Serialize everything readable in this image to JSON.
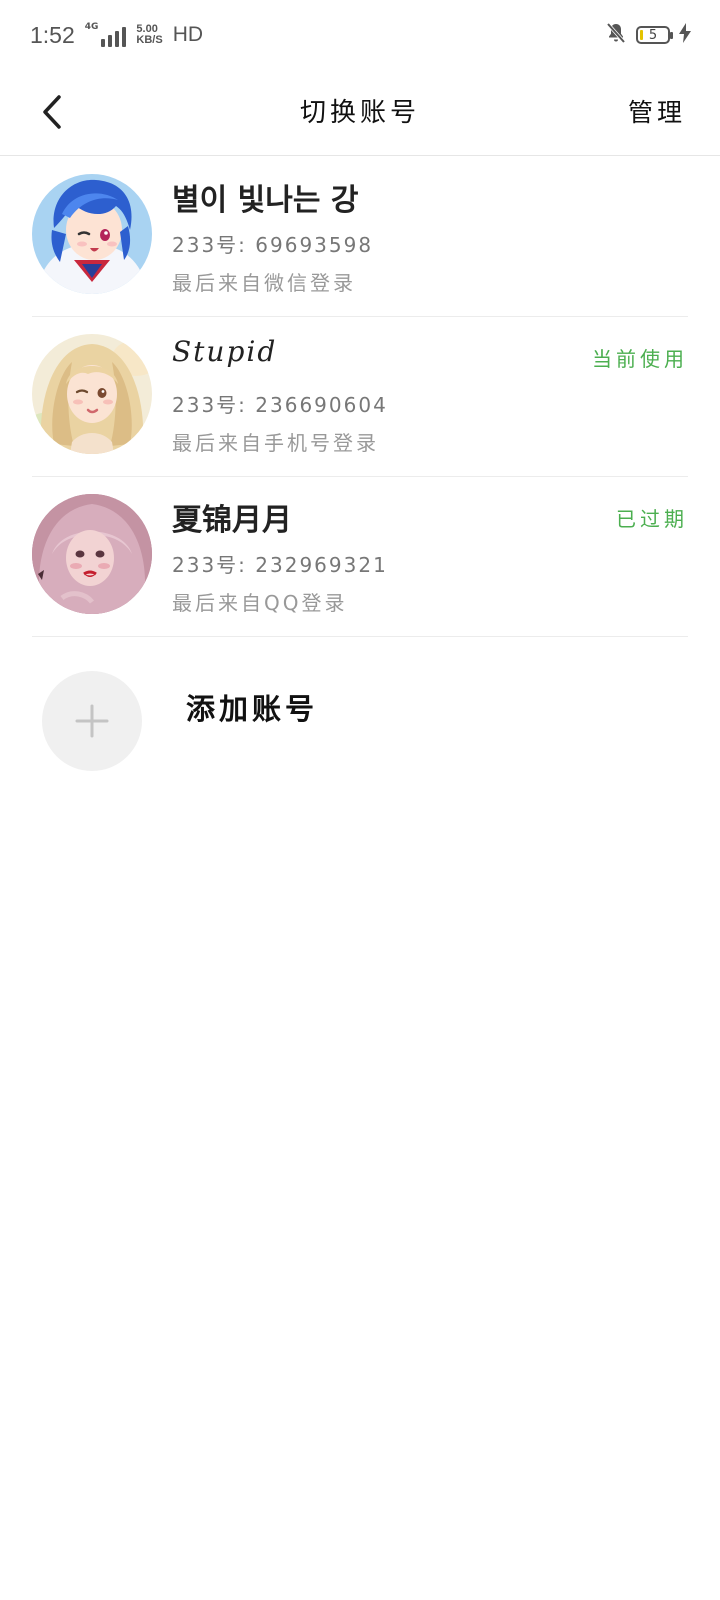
{
  "status_bar": {
    "time": "1:52",
    "network_gen": "4G",
    "speed_value": "5.00",
    "speed_unit": "KB/S",
    "hd": "HD",
    "battery_level": "5"
  },
  "nav": {
    "title": "切换账号",
    "manage_label": "管理"
  },
  "accounts": [
    {
      "name": "별이 빛나는 강",
      "id_line": "233号: 69693598",
      "last_login": "最后来自微信登录",
      "status": ""
    },
    {
      "name": "Stupid",
      "id_line": "233号: 236690604",
      "last_login": "最后来自手机号登录",
      "status": "当前使用"
    },
    {
      "name": "夏锦月月",
      "id_line": "233号: 232969321",
      "last_login": "最后来自QQ登录",
      "status": "已过期"
    }
  ],
  "add_account": {
    "label": "添加账号"
  },
  "colors": {
    "status_green": "#4caf50",
    "divider": "#ececec",
    "add_circle_bg": "#f0f0f0"
  }
}
